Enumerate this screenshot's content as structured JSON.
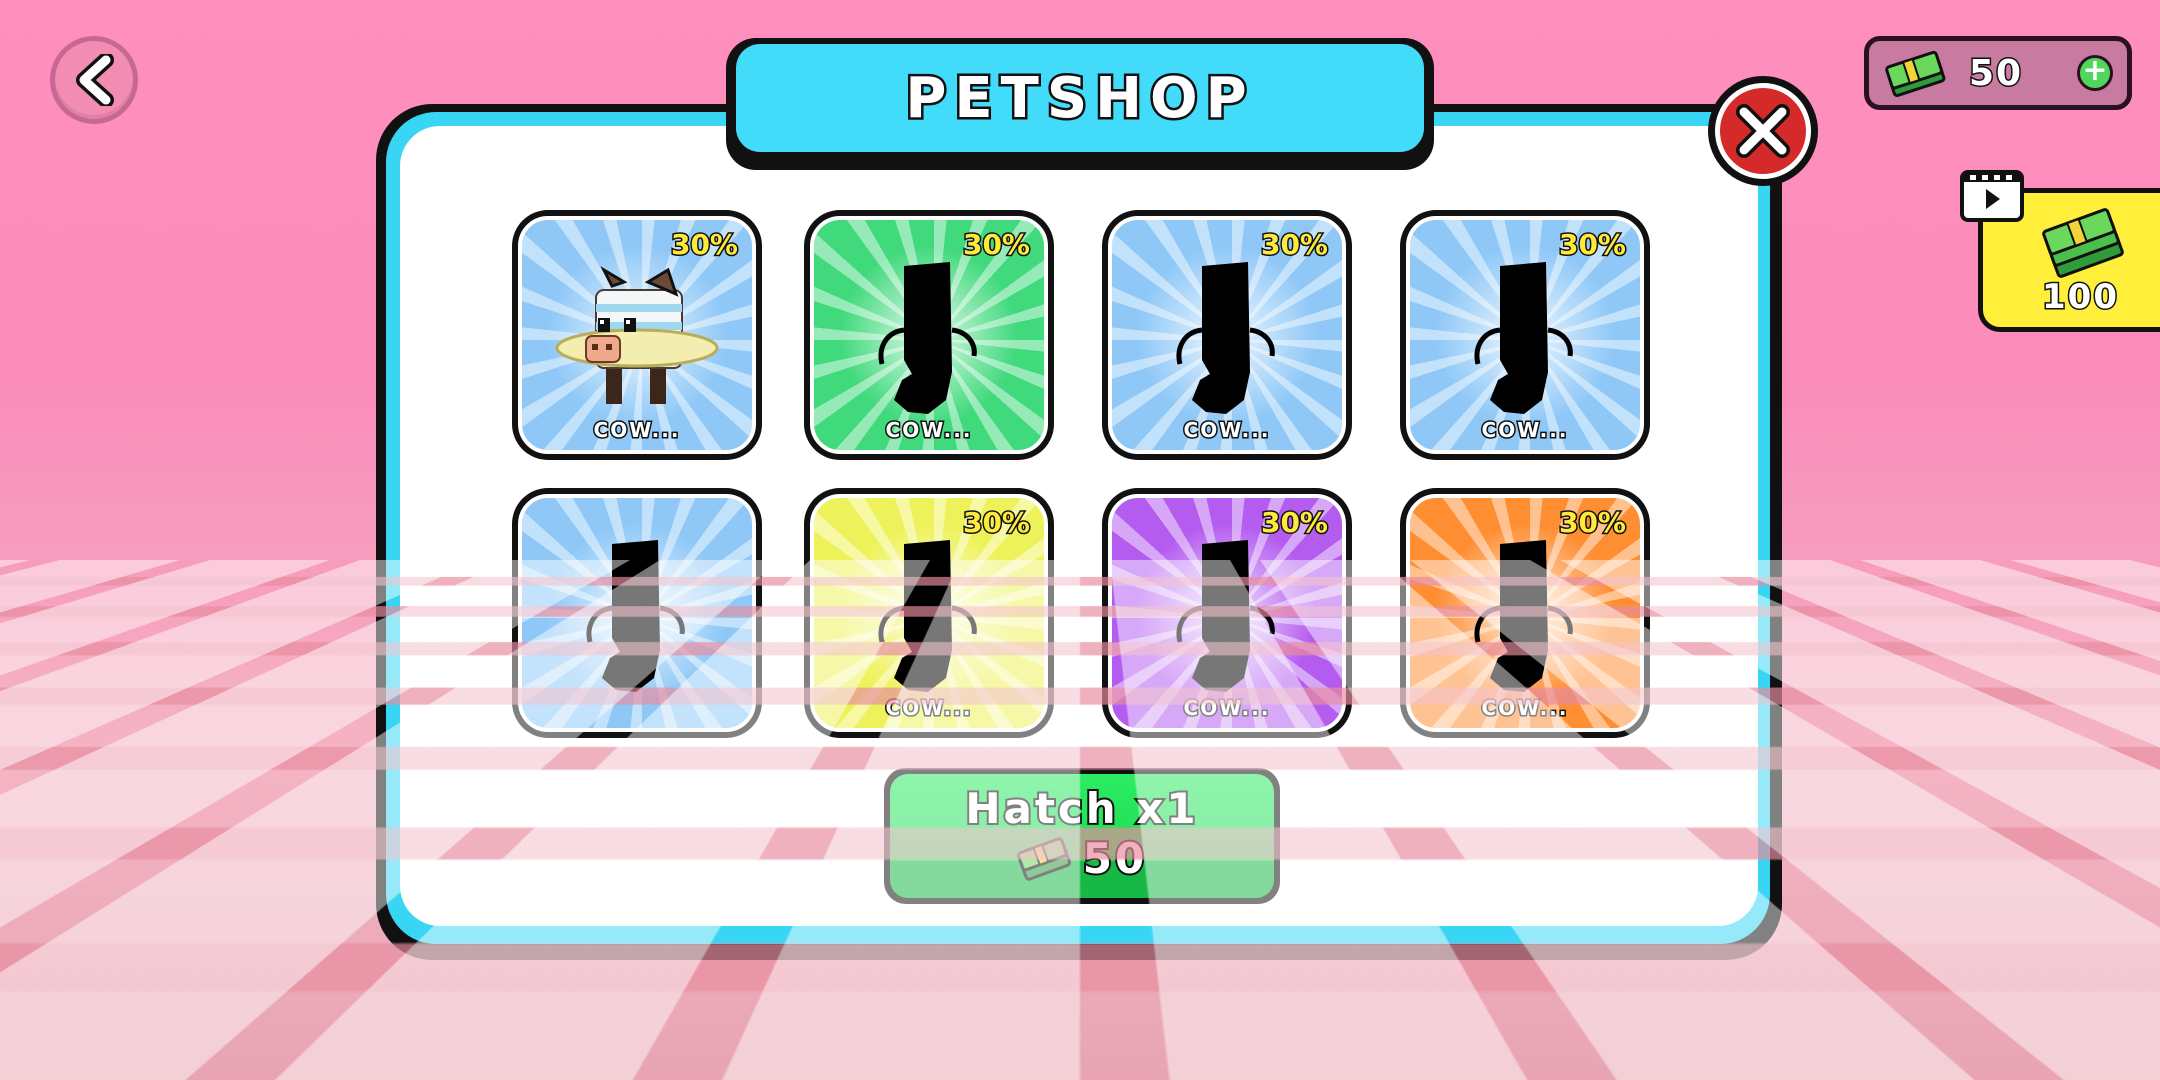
{
  "header": {
    "title": "PETSHOP"
  },
  "currency": {
    "amount": "50",
    "icon": "cash-icon",
    "add_icon": "plus-icon"
  },
  "ad_reward": {
    "amount": "100",
    "icon": "video-icon"
  },
  "pets": [
    {
      "chance": "30%",
      "name": "COW...",
      "revealed": true,
      "color": "#8fc8f7"
    },
    {
      "chance": "30%",
      "name": "COW...",
      "revealed": false,
      "color": "#40d97c"
    },
    {
      "chance": "30%",
      "name": "COW...",
      "revealed": false,
      "color": "#8fc8f7"
    },
    {
      "chance": "30%",
      "name": "COW...",
      "revealed": false,
      "color": "#8fc8f7"
    },
    {
      "chance": "",
      "name": "",
      "revealed": false,
      "color": "#8fc8f7"
    },
    {
      "chance": "30%",
      "name": "COW...",
      "revealed": false,
      "color": "#eef25a"
    },
    {
      "chance": "30%",
      "name": "COW...",
      "revealed": false,
      "color": "#b45cf0"
    },
    {
      "chance": "30%",
      "name": "COW...",
      "revealed": false,
      "color": "#ff8e33"
    }
  ],
  "hatch": {
    "label": "Hatch x1",
    "cost": "50"
  },
  "colors": {
    "panel_border": "#38d6f4",
    "close_red": "#d42a2a",
    "hatch_green": "#22e25a",
    "background_pink": "#ff8fbd",
    "ad_yellow": "#ffef3a"
  }
}
